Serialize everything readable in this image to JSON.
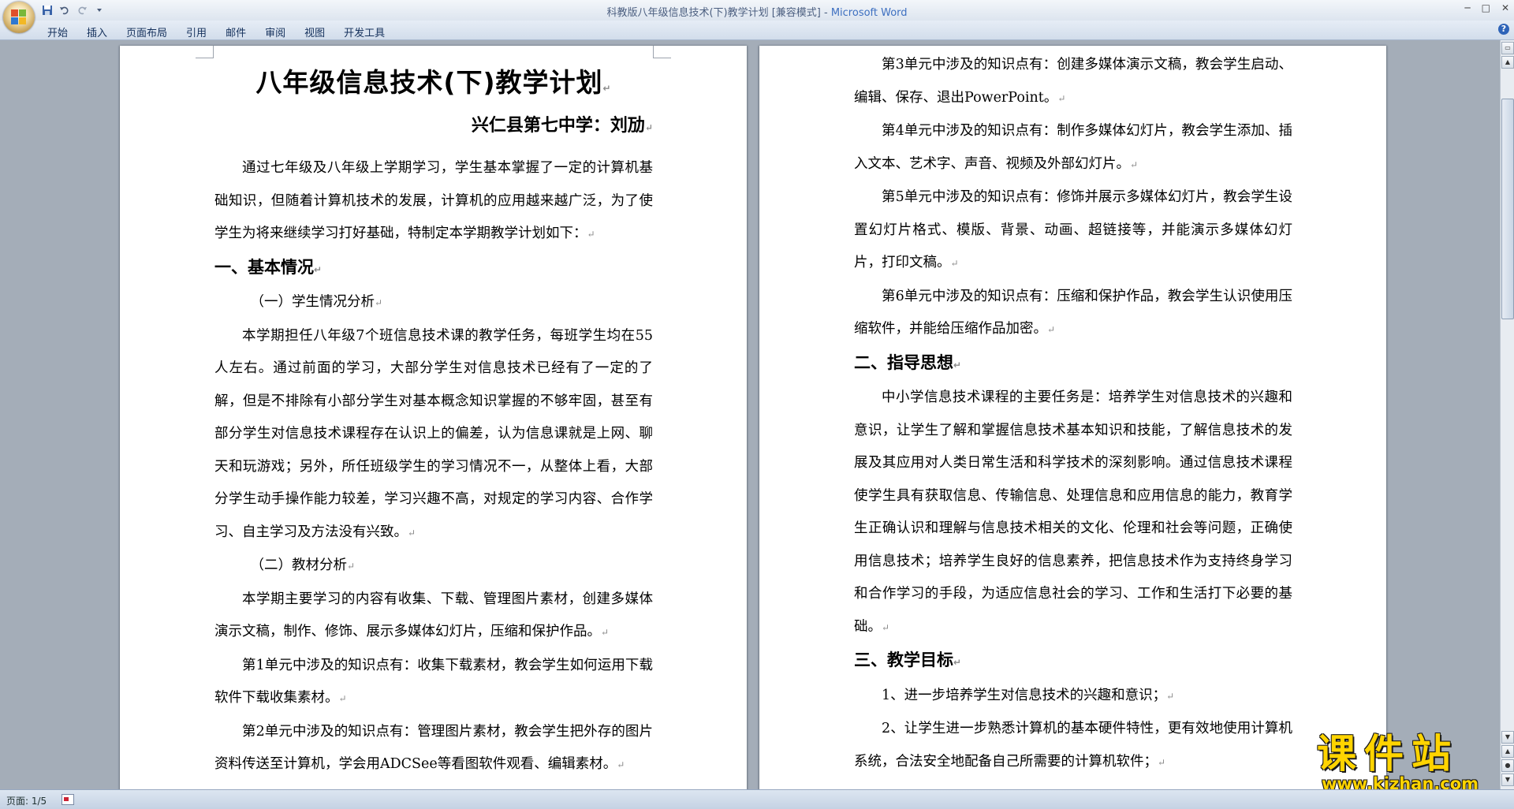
{
  "window": {
    "title": "科教版八年级信息技术(下)教学计划 [兼容模式] - ",
    "app_name": "Microsoft Word",
    "controls": [
      "─",
      "□",
      "✕"
    ]
  },
  "quick_access": {
    "save_icon": "save-icon",
    "undo_icon": "undo-icon",
    "redo_icon": "redo-icon",
    "customize_icon": "chevron-down-icon"
  },
  "ribbon": {
    "tabs": [
      {
        "label": "开始"
      },
      {
        "label": "插入"
      },
      {
        "label": "页面布局"
      },
      {
        "label": "引用"
      },
      {
        "label": "邮件"
      },
      {
        "label": "审阅"
      },
      {
        "label": "视图"
      },
      {
        "label": "开发工具"
      }
    ],
    "help_label": "?"
  },
  "page1": {
    "title": "八年级信息技术(下)教学计划",
    "author": "兴仁县第七中学：刘劢",
    "intro": "通过七年级及八年级上学期学习，学生基本掌握了一定的计算机基础知识，但随着计算机技术的发展，计算机的应用越来越广泛，为了使学生为将来继续学习打好基础，特制定本学期教学计划如下：",
    "h1": "一、基本情况",
    "sub1": "（一）学生情况分析",
    "p_students": "本学期担任八年级7个班信息技术课的教学任务，每班学生均在55人左右。通过前面的学习，大部分学生对信息技术已经有了一定的了解，但是不排除有小部分学生对基本概念知识掌握的不够牢固，甚至有部分学生对信息技术课程存在认识上的偏差，认为信息课就是上网、聊天和玩游戏；另外，所任班级学生的学习情况不一，从整体上看，大部分学生动手操作能力较差，学习兴趣不高，对规定的学习内容、合作学习、自主学习及方法没有兴致。",
    "sub2": "（二）教材分析",
    "p_material": "本学期主要学习的内容有收集、下载、管理图片素材，创建多媒体演示文稿，制作、修饰、展示多媒体幻灯片，压缩和保护作品。",
    "p_unit1": "第1单元中涉及的知识点有：收集下载素材，教会学生如何运用下载软件下载收集素材。",
    "p_unit2": "第2单元中涉及的知识点有：管理图片素材，教会学生把外存的图片资料传送至计算机，学会用ADCSee等看图软件观看、编辑素材。"
  },
  "page2": {
    "p_unit3": "第3单元中涉及的知识点有：创建多媒体演示文稿，教会学生启动、编辑、保存、退出PowerPoint。",
    "p_unit4": "第4单元中涉及的知识点有：制作多媒体幻灯片，教会学生添加、插入文本、艺术字、声音、视频及外部幻灯片。",
    "p_unit5": "第5单元中涉及的知识点有：修饰并展示多媒体幻灯片，教会学生设置幻灯片格式、模版、背景、动画、超链接等，并能演示多媒体幻灯片，打印文稿。",
    "p_unit6": "第6单元中涉及的知识点有：压缩和保护作品，教会学生认识使用压缩软件，并能给压缩作品加密。",
    "h2": "二、指导思想",
    "p_guide": "中小学信息技术课程的主要任务是：培养学生对信息技术的兴趣和意识，让学生了解和掌握信息技术基本知识和技能，了解信息技术的发展及其应用对人类日常生活和科学技术的深刻影响。通过信息技术课程使学生具有获取信息、传输信息、处理信息和应用信息的能力，教育学生正确认识和理解与信息技术相关的文化、伦理和社会等问题，正确使用信息技术；培养学生良好的信息素养，把信息技术作为支持终身学习和合作学习的手段，为适应信息社会的学习、工作和生活打下必要的基础。",
    "h3": "三、教学目标",
    "goal1": "1、进一步培养学生对信息技术的兴趣和意识；",
    "goal2": "2、让学生进一步熟悉计算机的基本硬件特性，更有效地使用计算机系统，合法安全地配备自己所需要的计算机软件；"
  },
  "paragraph_mark": "↵",
  "status": {
    "page": "页面: 1/5"
  },
  "watermark": {
    "title": "课件站",
    "url": "www.kjzhan.com"
  },
  "colors": {
    "background": "#a4adb8",
    "title_app": "#3d6fc0",
    "watermark": "#ffd400"
  }
}
